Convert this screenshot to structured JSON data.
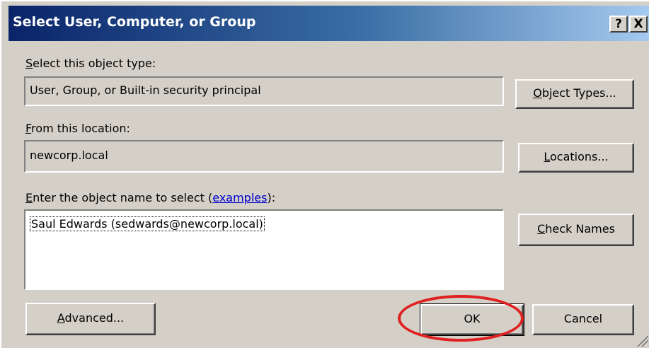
{
  "window": {
    "title": "Select User, Computer, or Group",
    "help_glyph": "?",
    "close_glyph": "X"
  },
  "object_type": {
    "label_acc": "S",
    "label_rest": "elect this object type:",
    "value": "User, Group, or Built-in security principal",
    "button_acc": "O",
    "button_rest": "bject Types..."
  },
  "location": {
    "label_acc": "F",
    "label_rest": "rom this location:",
    "value": "newcorp.local",
    "button_acc": "L",
    "button_rest": "ocations..."
  },
  "object_name": {
    "label_acc": "E",
    "label_rest": "nter the object name to select (",
    "link": "examples",
    "label_end": "):",
    "value": "Saul Edwards (sedwards@newcorp.local)",
    "button_acc": "C",
    "button_rest": "heck Names"
  },
  "footer": {
    "advanced_acc": "A",
    "advanced_rest": "dvanced...",
    "ok": "OK",
    "cancel": "Cancel"
  },
  "colors": {
    "highlight_ring": "#e02020",
    "title_gradient_start": "#0a246a"
  }
}
